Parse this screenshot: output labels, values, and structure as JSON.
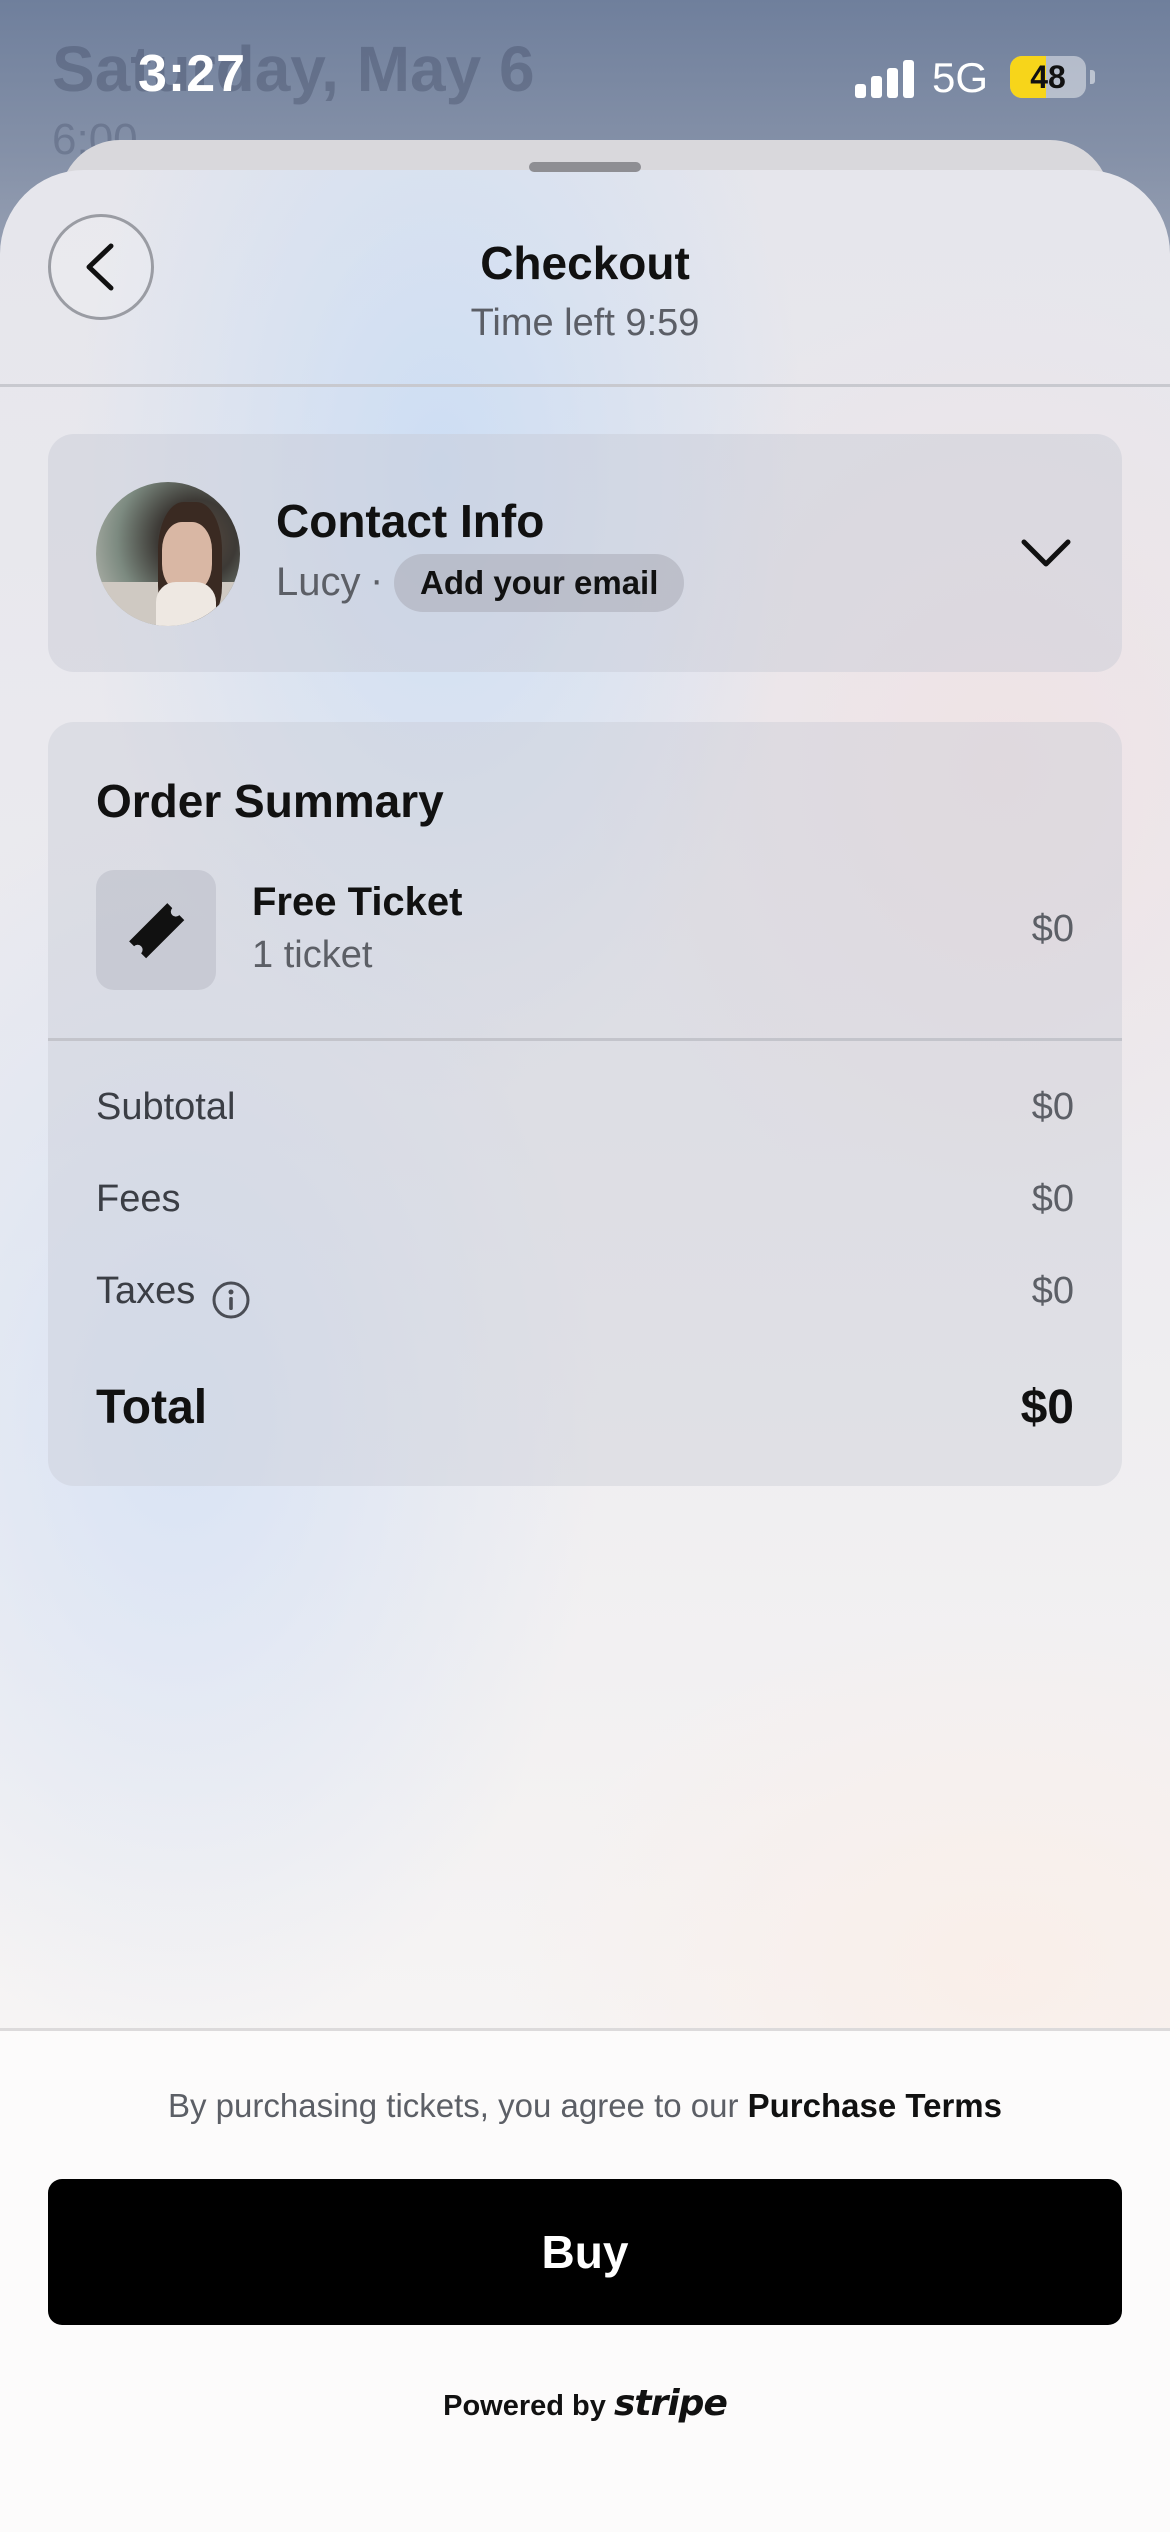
{
  "status_bar": {
    "time": "3:27",
    "network": "5G",
    "battery": "48",
    "battery_fraction": 0.48
  },
  "background_app": {
    "title": "Saturday, May 6",
    "subtitle": "6:00"
  },
  "header": {
    "title": "Checkout",
    "subtitle": "Time left 9:59"
  },
  "contact": {
    "title": "Contact Info",
    "name": "Lucy",
    "separator": "·",
    "email_button": "Add your email"
  },
  "order": {
    "title": "Order Summary",
    "item": {
      "name": "Free Ticket",
      "quantity": "1 ticket",
      "price": "$0"
    },
    "rows": [
      {
        "label": "Subtotal",
        "value": "$0"
      },
      {
        "label": "Fees",
        "value": "$0"
      },
      {
        "label": "Taxes",
        "value": "$0"
      }
    ],
    "total": {
      "label": "Total",
      "value": "$0"
    }
  },
  "footer": {
    "terms_prefix": "By purchasing tickets, you agree to our ",
    "terms_link": "Purchase Terms",
    "buy_label": "Buy",
    "powered_prefix": "Powered by",
    "powered_brand": "stripe"
  },
  "colors": {
    "accent_battery": "#f7d51a",
    "button_bg": "#000000"
  }
}
